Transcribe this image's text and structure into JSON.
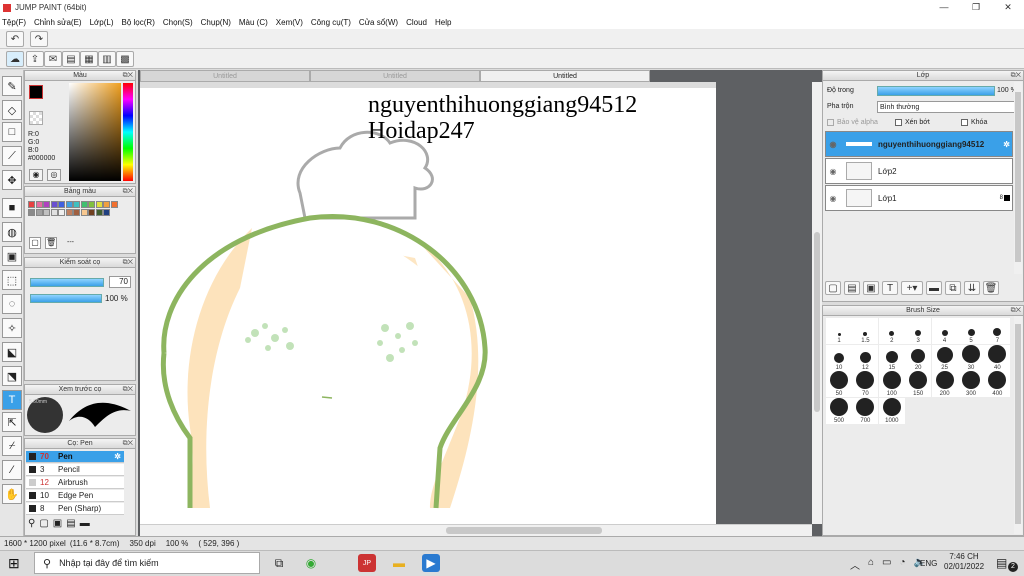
{
  "window": {
    "title": "JUMP PAINT (64bit)"
  },
  "menu": [
    "Tệp(F)",
    "Chỉnh sửa(E)",
    "Lớp(L)",
    "Bộ lọc(R)",
    "Chọn(S)",
    "Chụp(N)",
    "Màu (C)",
    "Xem(V)",
    "Công cụ(T)",
    "Cửa sổ(W)",
    "Cloud",
    "Help"
  ],
  "tabs": [
    "Untitled",
    "Untitled",
    "Untitled"
  ],
  "color_panel": {
    "title": "Màu",
    "rgb": [
      "R:0",
      "G:0",
      "B:0"
    ],
    "hex": "#000000"
  },
  "palette_panel": {
    "title": "Bảng màu",
    "more": "---",
    "swatches": [
      "#e84040",
      "#e86aa0",
      "#b040c0",
      "#6a50d0",
      "#4060e0",
      "#40a0e0",
      "#40c0c0",
      "#40c070",
      "#80c040",
      "#e0e040",
      "#f0a040",
      "#f07030",
      "#8a8a8a",
      "#a0a0a0",
      "#c0c0c0",
      "#e0e0e0",
      "#f0f0f0",
      "#c08060",
      "#a06040",
      "#f8c890",
      "#704020",
      "#406030",
      "#204080"
    ]
  },
  "brush_control": {
    "title": "Kiểm soát cọ",
    "size": "70",
    "opacity": "100 %"
  },
  "preview_panel": {
    "title": "Xem trước cọ",
    "size_label": "5.60mm"
  },
  "brush_list": {
    "title": "Cọ: Pen",
    "items": [
      {
        "size": "70",
        "name": "Pen",
        "red": true
      },
      {
        "size": "3",
        "name": "Pencil",
        "red": false
      },
      {
        "size": "12",
        "name": "Airbrush",
        "red": true
      },
      {
        "size": "10",
        "name": "Edge Pen",
        "red": false
      },
      {
        "size": "8",
        "name": "Pen (Sharp)",
        "red": false
      }
    ]
  },
  "canvas": {
    "text_line1": "nguyenthihuonggiang94512",
    "text_line2": "Hoidap247"
  },
  "layer_panel": {
    "title": "Lớp",
    "opacity_label": "Độ trong",
    "opacity_value": "100 %",
    "opacity_fraction": 1.0,
    "blend_label": "Pha trộn",
    "blend_value": "Bình thường",
    "protect_alpha": "Bảo vệ alpha",
    "clipping": "Xén bớt",
    "lock": "Khóa",
    "layers": [
      {
        "name": "nguyenthihuonggiang94512"
      },
      {
        "name": "Lớp2"
      },
      {
        "name": "Lớp1"
      }
    ],
    "lop1_badge": "8"
  },
  "brush_size_panel": {
    "title": "Brush Size",
    "sizes": [
      "1",
      "1.5",
      "2",
      "3",
      "4",
      "5",
      "7",
      "10",
      "12",
      "15",
      "20",
      "25",
      "30",
      "40",
      "50",
      "70",
      "100",
      "150",
      "200",
      "300",
      "400",
      "500",
      "700",
      "1000"
    ]
  },
  "status": {
    "dimensions": "1600 * 1200 pixel",
    "physical": "(11.6 * 8.7cm)",
    "dpi": "350 dpi",
    "zoom": "100 %",
    "coords": "( 529, 396 )"
  },
  "taskbar": {
    "search_placeholder": "Nhập tại đây để tìm kiếm",
    "lang": "ENG",
    "time": "7:46 CH",
    "date": "02/01/2022",
    "notif_count": "2"
  }
}
